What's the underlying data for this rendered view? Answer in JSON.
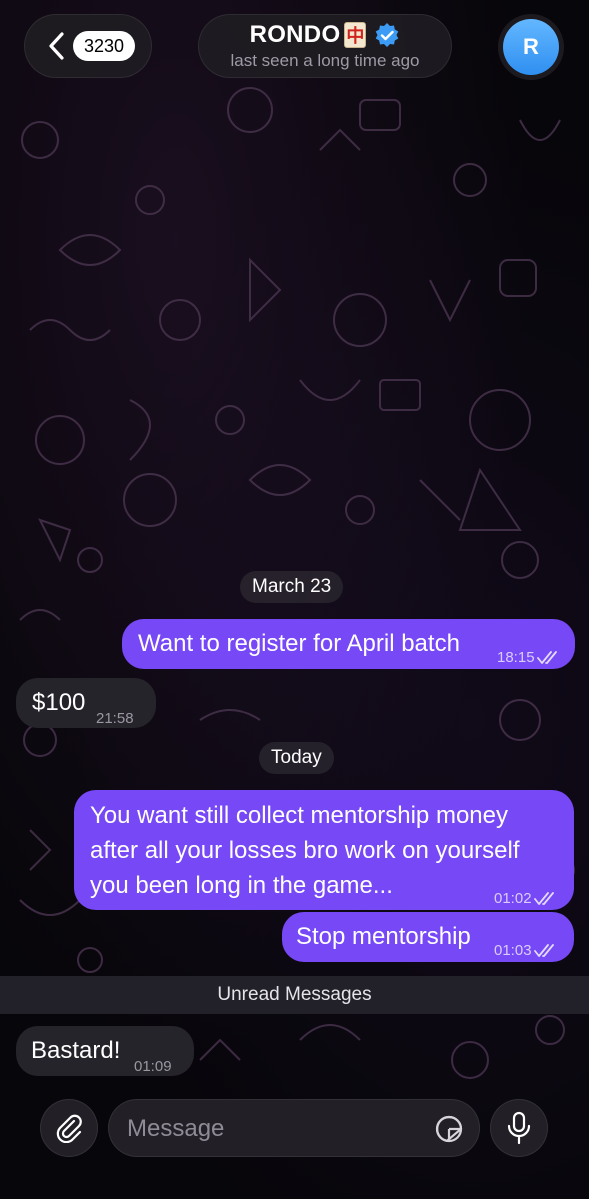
{
  "header": {
    "back_count": "3230",
    "title": "RONDO",
    "title_emoji": "🀄",
    "status": "last seen a long time ago",
    "avatar_letter": "R"
  },
  "messages": [
    {
      "type": "date",
      "label": "March 23"
    },
    {
      "type": "outgoing",
      "text": "Want to register for April batch",
      "time": "18:15",
      "read": true
    },
    {
      "type": "incoming",
      "text": "$100",
      "time": "21:58"
    },
    {
      "type": "date",
      "label": "Today"
    },
    {
      "type": "outgoing",
      "lines": [
        "You want still collect mentorship money",
        "after all your losses bro work on yourself",
        "you been long in the game..."
      ],
      "time": "01:02",
      "read": true
    },
    {
      "type": "outgoing",
      "text": "Stop mentorship",
      "time": "01:03",
      "read": true
    },
    {
      "type": "divider",
      "label": "Unread Messages"
    },
    {
      "type": "incoming",
      "text": "Bastard!",
      "time": "01:09"
    }
  ],
  "composer": {
    "placeholder": "Message"
  },
  "colors": {
    "outgoing_bubble": "#7748f5",
    "incoming_bubble": "#26242b",
    "verified": "#3c9cf5",
    "avatar": "#3a97f2"
  },
  "icons": [
    "chevron-left-icon",
    "verified-badge-icon",
    "paperclip-icon",
    "sticker-icon",
    "microphone-icon",
    "double-check-icon"
  ]
}
